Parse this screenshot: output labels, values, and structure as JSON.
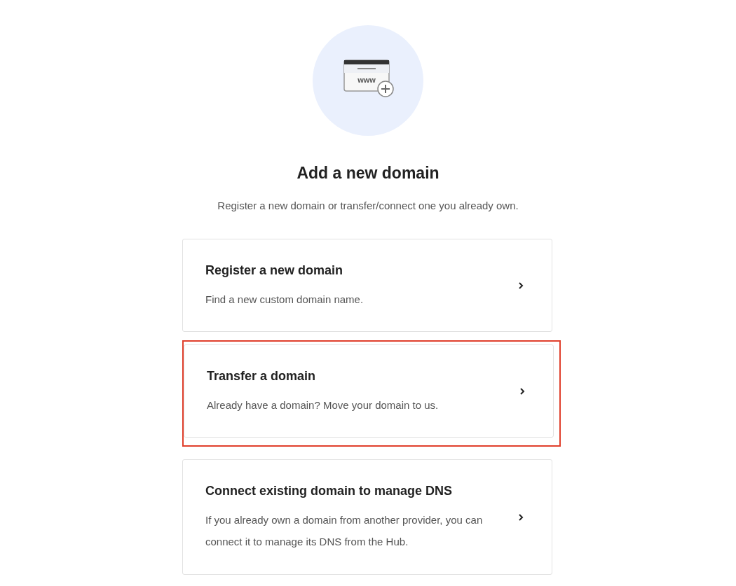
{
  "header": {
    "icon_text": "www",
    "title": "Add a new domain",
    "subtitle": "Register a new domain or transfer/connect one you already own."
  },
  "options": [
    {
      "title": "Register a new domain",
      "description": "Find a new custom domain name.",
      "highlighted": false
    },
    {
      "title": "Transfer a domain",
      "description": "Already have a domain? Move your domain to us.",
      "highlighted": true
    },
    {
      "title": "Connect existing domain to manage DNS",
      "description": "If you already own a domain from another provider, you can connect it to manage its DNS from the Hub.",
      "highlighted": false
    }
  ]
}
